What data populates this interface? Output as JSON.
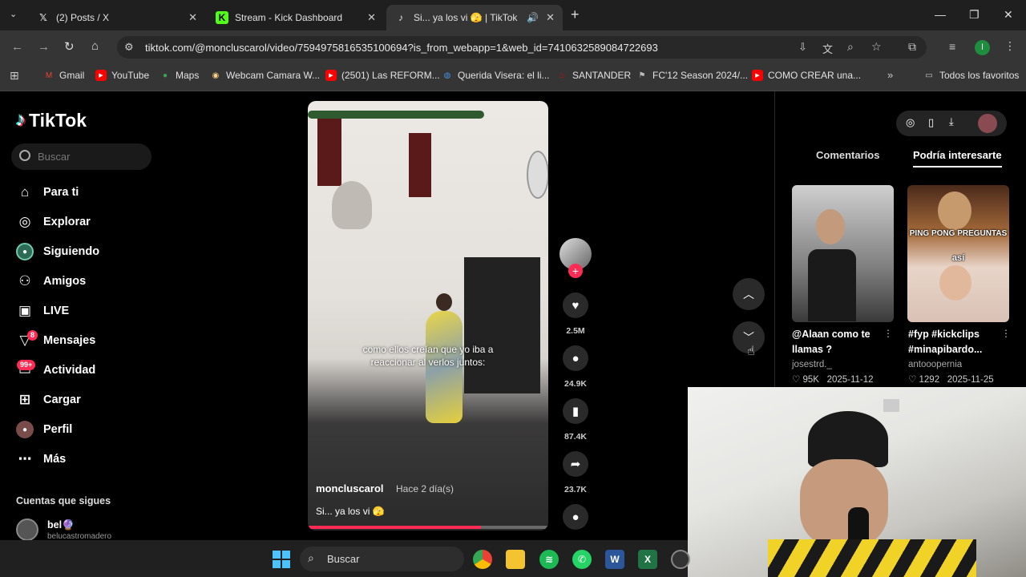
{
  "browser": {
    "tabs": [
      {
        "title": "(2) Posts / X",
        "icon": "x-logo-icon"
      },
      {
        "title": "Stream - Kick Dashboard",
        "icon": "kick-logo-icon"
      },
      {
        "title": "Si... ya los vi 🫣 | TikTok",
        "icon": "tiktok-logo-icon"
      }
    ],
    "url": "tiktok.com/@moncluscarol/video/7594975816535100694?is_from_webapp=1&web_id=7410632589084722693",
    "bookmarks": [
      "Gmail",
      "YouTube",
      "Maps",
      "Webcam Camara W...",
      "(2501) Las REFORM...",
      "Querida Visera: el li...",
      "SANTANDER",
      "FC'12 Season 2024/...",
      "COMO CREAR una..."
    ],
    "all_bookmarks": "Todos los favoritos",
    "profile_initial": "I"
  },
  "sidebar": {
    "logo": "TikTok",
    "search_placeholder": "Buscar",
    "items": [
      {
        "label": "Para ti",
        "icon": "home-icon"
      },
      {
        "label": "Explorar",
        "icon": "compass-icon"
      },
      {
        "label": "Siguiendo",
        "icon": "following-avatar-icon"
      },
      {
        "label": "Amigos",
        "icon": "friends-icon"
      },
      {
        "label": "LIVE",
        "icon": "live-icon"
      },
      {
        "label": "Mensajes",
        "icon": "messages-icon",
        "badge": "8"
      },
      {
        "label": "Actividad",
        "icon": "activity-icon",
        "badge": "99+"
      },
      {
        "label": "Cargar",
        "icon": "upload-icon"
      },
      {
        "label": "Perfil",
        "icon": "profile-icon"
      },
      {
        "label": "Más",
        "icon": "more-icon"
      }
    ],
    "following_title": "Cuentas que sigues",
    "following": [
      {
        "name": "bel🔮",
        "handle": "belucastromadero"
      }
    ]
  },
  "video": {
    "caption_overlay": "como ellos creían que yo iba a reaccionar al verlos juntos:",
    "author": "moncluscarol",
    "time": "Hace 2 día(s)",
    "description": "Si... ya los vi 🫣",
    "progress": 0.72
  },
  "actions": {
    "likes": "2.5M",
    "comments": "24.9K",
    "saves": "87.4K",
    "shares": "23.7K"
  },
  "right_panel": {
    "tabs": [
      "Comentarios",
      "Podría interesarte"
    ],
    "cards": [
      {
        "title": "@Alaan como te llamas ?",
        "author": "josestrd._",
        "views": "95K",
        "date": "2025-11-12"
      },
      {
        "title": "#fyp #kickclips #minapibardo...",
        "author": "antooopernia",
        "views": "1292",
        "date": "2025-11-25",
        "overlay_text": "PING PONG PREGUNTAS",
        "overlay_sub": "así"
      }
    ]
  },
  "taskbar": {
    "search_placeholder": "Buscar"
  },
  "colors": {
    "accent": "#fe2c55",
    "kick_green": "#53fc18"
  }
}
